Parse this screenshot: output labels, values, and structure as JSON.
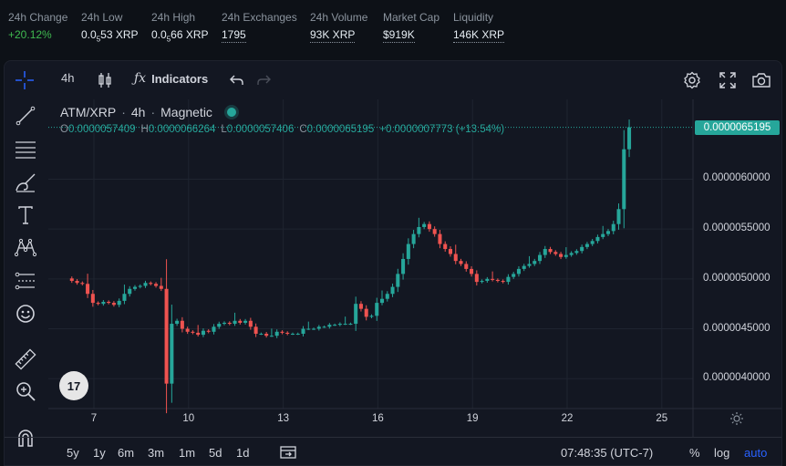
{
  "stats": [
    {
      "label": "24h Change",
      "value": "+20.12%",
      "style": "green"
    },
    {
      "label": "24h Low",
      "value_prefix": "0.0",
      "value_sub": "5",
      "value_suffix": "53 XRP"
    },
    {
      "label": "24h High",
      "value_prefix": "0.0",
      "value_sub": "5",
      "value_suffix": "66 XRP"
    },
    {
      "label": "24h Exchanges",
      "value": "1795",
      "style": "dotted"
    },
    {
      "label": "24h Volume",
      "value": "93K XRP",
      "style": "dotted"
    },
    {
      "label": "Market Cap",
      "value": "$919K",
      "style": "dotted"
    },
    {
      "label": "Liquidity",
      "value": "146K XRP",
      "style": "dotted"
    }
  ],
  "toolbar": {
    "interval": "4h",
    "indicators_label": "Indicators"
  },
  "legend": {
    "symbol": "ATM/XRP",
    "interval": "4h",
    "mode": "Magnetic",
    "o_label": "O",
    "o": "0.0000057409",
    "h_label": "H",
    "h": "0.0000066264",
    "l_label": "L",
    "l": "0.0000057406",
    "c_label": "C",
    "c": "0.0000065195",
    "change": "+0.0000007773 (+13.54%)"
  },
  "price_tag": "0.0000065195",
  "bottom": {
    "ranges": [
      "5y",
      "1y",
      "6m",
      "3m",
      "1m",
      "5d",
      "1d"
    ],
    "time": "07:48:35 (UTC-7)",
    "pct": "%",
    "log": "log",
    "auto": "auto"
  },
  "icons": {
    "crosshair": "crosshair-icon",
    "trendline": "trendline-icon",
    "fib": "fib-icon",
    "brush": "brush-icon",
    "text": "text-icon",
    "pattern": "pattern-icon",
    "measure": "measure-icon",
    "emoji": "emoji-icon",
    "ruler": "ruler-icon",
    "zoom": "zoom-icon",
    "magnet": "magnet-icon"
  },
  "colors": {
    "up": "#26a69a",
    "down": "#ef5350",
    "accent": "#2962ff",
    "bg": "#131722"
  },
  "chart_data": {
    "type": "candlestick",
    "title": "ATM/XRP · 4h",
    "ylim": [
      3.7e-06,
      6.8e-06
    ],
    "yticks": [
      "0.0000040000",
      "0.0000045000",
      "0.0000050000",
      "0.0000055000",
      "0.0000060000"
    ],
    "ytick_values": [
      4e-06,
      4.5e-06,
      5e-06,
      5.5e-06,
      6e-06
    ],
    "xticks": [
      "7",
      "10",
      "13",
      "16",
      "19",
      "22",
      "25"
    ],
    "xtick_days": [
      7,
      10,
      13,
      16,
      19,
      22,
      25
    ],
    "x_start_day": 6.3,
    "candles_per_day": 6,
    "last_price": 6.5195e-06,
    "closes": [
      4.98,
      4.96,
      4.95,
      4.85,
      4.76,
      4.75,
      4.77,
      4.76,
      4.74,
      4.78,
      4.85,
      4.9,
      4.92,
      4.93,
      4.96,
      4.95,
      4.93,
      4.9,
      3.95,
      4.55,
      4.58,
      4.5,
      4.47,
      4.46,
      4.44,
      4.48,
      4.47,
      4.52,
      4.55,
      4.56,
      4.55,
      4.58,
      4.56,
      4.58,
      4.52,
      4.45,
      4.45,
      4.43,
      4.43,
      4.47,
      4.46,
      4.45,
      4.45,
      4.45,
      4.5,
      4.5,
      4.5,
      4.52,
      4.52,
      4.54,
      4.54,
      4.55,
      4.55,
      4.55,
      4.75,
      4.7,
      4.62,
      4.63,
      4.76,
      4.8,
      4.85,
      4.92,
      5.05,
      5.2,
      5.35,
      5.45,
      5.52,
      5.55,
      5.5,
      5.45,
      5.35,
      5.3,
      5.25,
      5.18,
      5.15,
      5.1,
      5.05,
      4.97,
      4.98,
      5.0,
      4.99,
      4.98,
      4.97,
      5.02,
      5.05,
      5.1,
      5.13,
      5.15,
      5.18,
      5.24,
      5.3,
      5.27,
      5.25,
      5.22,
      5.24,
      5.26,
      5.28,
      5.32,
      5.35,
      5.38,
      5.42,
      5.45,
      5.48,
      5.55,
      5.7,
      6.3,
      6.52
    ]
  }
}
